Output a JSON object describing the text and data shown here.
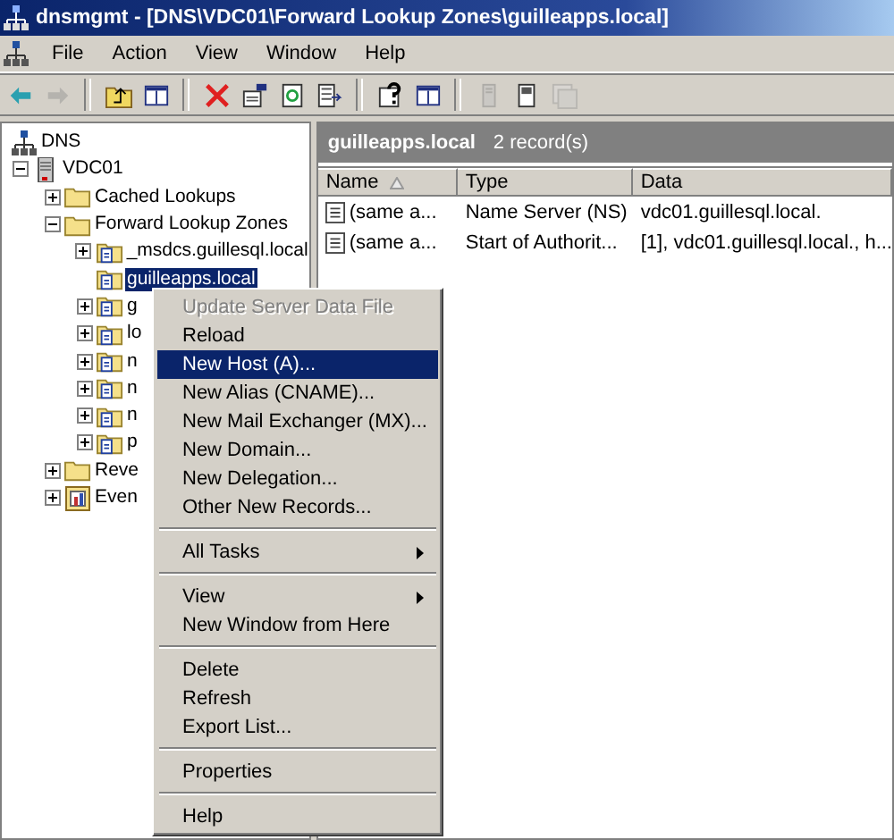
{
  "window": {
    "title": "dnsmgmt - [DNS\\VDC01\\Forward Lookup Zones\\guilleapps.local]"
  },
  "menu_bar": [
    "File",
    "Action",
    "View",
    "Window",
    "Help"
  ],
  "toolbar": [
    {
      "kind": "back",
      "disabled": false
    },
    {
      "kind": "forward",
      "disabled": true
    },
    {
      "kind": "separator"
    },
    {
      "kind": "up",
      "disabled": false
    },
    {
      "kind": "pane",
      "disabled": false
    },
    {
      "kind": "separator"
    },
    {
      "kind": "delete",
      "disabled": false
    },
    {
      "kind": "properties",
      "disabled": false
    },
    {
      "kind": "refresh",
      "disabled": false
    },
    {
      "kind": "export",
      "disabled": false
    },
    {
      "kind": "separator"
    },
    {
      "kind": "help",
      "disabled": false
    },
    {
      "kind": "pane",
      "disabled": false
    },
    {
      "kind": "separator"
    },
    {
      "kind": "server",
      "disabled": true
    },
    {
      "kind": "record",
      "disabled": false
    },
    {
      "kind": "records",
      "disabled": true
    }
  ],
  "tree": [
    {
      "label": "DNS",
      "kind": "root",
      "selected": false,
      "children": [
        {
          "label": "VDC01",
          "kind": "server",
          "selected": false,
          "expanded": true,
          "leaf": false,
          "children": [
            {
              "label": "Cached Lookups",
              "kind": "folder",
              "selected": false,
              "expanded": false,
              "leaf": false
            },
            {
              "label": "Forward Lookup Zones",
              "kind": "folder",
              "selected": false,
              "expanded": true,
              "leaf": false,
              "children": [
                {
                  "label": "_msdcs.guillesql.local",
                  "kind": "zone",
                  "selected": false,
                  "expanded": false,
                  "leaf": false
                },
                {
                  "label": "guilleapps.local",
                  "kind": "zone",
                  "selected": true,
                  "expanded": false,
                  "leaf": true
                },
                {
                  "label": "g",
                  "kind": "zone",
                  "selected": false,
                  "expanded": false,
                  "leaf": false
                },
                {
                  "label": "lo",
                  "kind": "zone",
                  "selected": false,
                  "expanded": false,
                  "leaf": false
                },
                {
                  "label": "n",
                  "kind": "zone",
                  "selected": false,
                  "expanded": false,
                  "leaf": false
                },
                {
                  "label": "n",
                  "kind": "zone",
                  "selected": false,
                  "expanded": false,
                  "leaf": false
                },
                {
                  "label": "n",
                  "kind": "zone",
                  "selected": false,
                  "expanded": false,
                  "leaf": false
                },
                {
                  "label": "p",
                  "kind": "zone",
                  "selected": false,
                  "expanded": false,
                  "leaf": false
                }
              ]
            },
            {
              "label": "Reve",
              "kind": "folder",
              "selected": false,
              "expanded": false,
              "leaf": false
            },
            {
              "label": "Even",
              "kind": "log",
              "selected": false,
              "expanded": false,
              "leaf": false
            }
          ]
        }
      ]
    }
  ],
  "details": {
    "title": "guilleapps.local",
    "count": "2 record(s)",
    "columns": [
      {
        "label": "Name",
        "sorted": true
      },
      {
        "label": "Type",
        "sorted": false
      },
      {
        "label": "Data",
        "sorted": false
      }
    ],
    "rows": [
      [
        "(same a...",
        "Name Server (NS)",
        "vdc01.guillesql.local."
      ],
      [
        "(same a...",
        "Start of Authorit...",
        "[1], vdc01.guillesql.local., h..."
      ]
    ]
  },
  "context_menu": [
    {
      "kind": "item",
      "label": "Update Server Data File",
      "disabled": true,
      "selected": false,
      "submenu": false
    },
    {
      "kind": "item",
      "label": "Reload",
      "disabled": false,
      "selected": false,
      "submenu": false
    },
    {
      "kind": "item",
      "label": "New Host (A)...",
      "disabled": false,
      "selected": true,
      "submenu": false
    },
    {
      "kind": "item",
      "label": "New Alias (CNAME)...",
      "disabled": false,
      "selected": false,
      "submenu": false
    },
    {
      "kind": "item",
      "label": "New Mail Exchanger (MX)...",
      "disabled": false,
      "selected": false,
      "submenu": false
    },
    {
      "kind": "item",
      "label": "New Domain...",
      "disabled": false,
      "selected": false,
      "submenu": false
    },
    {
      "kind": "item",
      "label": "New Delegation...",
      "disabled": false,
      "selected": false,
      "submenu": false
    },
    {
      "kind": "item",
      "label": "Other New Records...",
      "disabled": false,
      "selected": false,
      "submenu": false
    },
    {
      "kind": "separator"
    },
    {
      "kind": "item",
      "label": "All Tasks",
      "disabled": false,
      "selected": false,
      "submenu": true
    },
    {
      "kind": "separator"
    },
    {
      "kind": "item",
      "label": "View",
      "disabled": false,
      "selected": false,
      "submenu": true
    },
    {
      "kind": "item",
      "label": "New Window from Here",
      "disabled": false,
      "selected": false,
      "submenu": false
    },
    {
      "kind": "separator"
    },
    {
      "kind": "item",
      "label": "Delete",
      "disabled": false,
      "selected": false,
      "submenu": false
    },
    {
      "kind": "item",
      "label": "Refresh",
      "disabled": false,
      "selected": false,
      "submenu": false
    },
    {
      "kind": "item",
      "label": "Export List...",
      "disabled": false,
      "selected": false,
      "submenu": false
    },
    {
      "kind": "separator"
    },
    {
      "kind": "item",
      "label": "Properties",
      "disabled": false,
      "selected": false,
      "submenu": false
    },
    {
      "kind": "separator"
    },
    {
      "kind": "item",
      "label": "Help",
      "disabled": false,
      "selected": false,
      "submenu": false
    }
  ]
}
